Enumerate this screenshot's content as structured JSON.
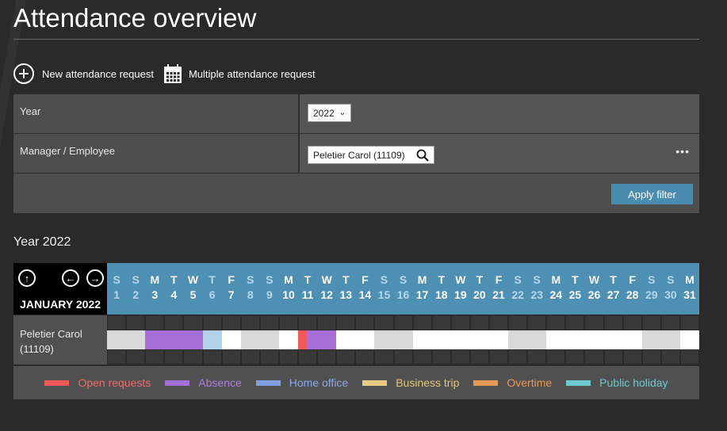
{
  "title": "Attendance overview",
  "actions": {
    "new_request": "New attendance request",
    "multiple_request": "Multiple attendance request"
  },
  "filter": {
    "year_label": "Year",
    "year_value": "2022",
    "employee_label": "Manager / Employee",
    "employee_value": "Peletier Carol (11109)",
    "more": "•••",
    "apply_label": "Apply filter"
  },
  "year_heading": "Year 2022",
  "calendar": {
    "month_label": "JANUARY 2022",
    "nav_up": "↑",
    "nav_prev": "←",
    "nav_next": "→",
    "days": [
      {
        "w": "S",
        "n": "1",
        "we": true
      },
      {
        "w": "S",
        "n": "2",
        "we": true
      },
      {
        "w": "M",
        "n": "3",
        "we": false
      },
      {
        "w": "T",
        "n": "4",
        "we": false
      },
      {
        "w": "W",
        "n": "5",
        "we": false
      },
      {
        "w": "T",
        "n": "6",
        "we": true
      },
      {
        "w": "F",
        "n": "7",
        "we": false
      },
      {
        "w": "S",
        "n": "8",
        "we": true
      },
      {
        "w": "S",
        "n": "9",
        "we": true
      },
      {
        "w": "M",
        "n": "10",
        "we": false
      },
      {
        "w": "T",
        "n": "11",
        "we": false
      },
      {
        "w": "W",
        "n": "12",
        "we": false
      },
      {
        "w": "T",
        "n": "13",
        "we": false
      },
      {
        "w": "F",
        "n": "14",
        "we": false
      },
      {
        "w": "S",
        "n": "15",
        "we": true
      },
      {
        "w": "S",
        "n": "16",
        "we": true
      },
      {
        "w": "M",
        "n": "17",
        "we": false
      },
      {
        "w": "T",
        "n": "18",
        "we": false
      },
      {
        "w": "W",
        "n": "19",
        "we": false
      },
      {
        "w": "T",
        "n": "20",
        "we": false
      },
      {
        "w": "F",
        "n": "21",
        "we": false
      },
      {
        "w": "S",
        "n": "22",
        "we": true
      },
      {
        "w": "S",
        "n": "23",
        "we": true
      },
      {
        "w": "M",
        "n": "24",
        "we": false
      },
      {
        "w": "T",
        "n": "25",
        "we": false
      },
      {
        "w": "W",
        "n": "26",
        "we": false
      },
      {
        "w": "T",
        "n": "27",
        "we": false
      },
      {
        "w": "F",
        "n": "28",
        "we": false
      },
      {
        "w": "S",
        "n": "29",
        "we": true
      },
      {
        "w": "S",
        "n": "30",
        "we": true
      },
      {
        "w": "M",
        "n": "31",
        "we": false
      }
    ],
    "employee": {
      "name": "Peletier Carol (11109)",
      "day_status": [
        "weekend",
        "weekend",
        "absence",
        "absence",
        "absence",
        "home_office",
        "workday",
        "weekend",
        "weekend",
        "workday",
        "open_absence",
        "absence",
        "workday",
        "workday",
        "weekend",
        "weekend",
        "workday",
        "workday",
        "workday",
        "workday",
        "workday",
        "weekend",
        "weekend",
        "workday",
        "workday",
        "workday",
        "workday",
        "workday",
        "weekend",
        "weekend",
        "workday"
      ]
    },
    "status_colors": {
      "weekend": "#d9d9d9",
      "workday": "#ffffff",
      "absence": "#a56ed6",
      "home_office": "#b3d2ea",
      "open": "#f25a5a"
    }
  },
  "legend": [
    {
      "label": "Open requests",
      "color": "#f25a5a",
      "text_color": "#f06a6a"
    },
    {
      "label": "Absence",
      "color": "#a56ed6",
      "text_color": "#b07ee0"
    },
    {
      "label": "Home office",
      "color": "#7f9fe0",
      "text_color": "#8aa8e8"
    },
    {
      "label": "Business trip",
      "color": "#e6cd86",
      "text_color": "#e3c777"
    },
    {
      "label": "Overtime",
      "color": "#e39a55",
      "text_color": "#e39a55"
    },
    {
      "label": "Public holiday",
      "color": "#6cc9cf",
      "text_color": "#6cc9cf"
    }
  ]
}
